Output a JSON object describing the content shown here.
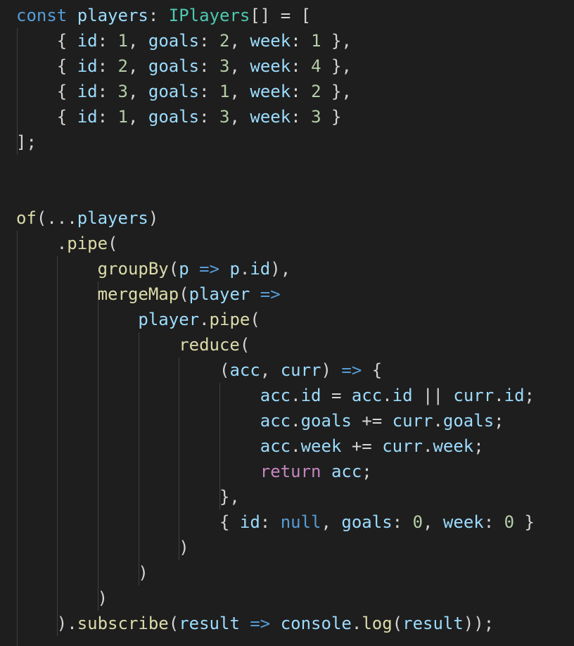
{
  "code": {
    "language": "typescript",
    "lines": [
      [
        {
          "t": "const",
          "c": "kw"
        },
        {
          "t": " ",
          "c": "plain"
        },
        {
          "t": "players",
          "c": "var"
        },
        {
          "t": ": ",
          "c": "punc"
        },
        {
          "t": "IPlayers",
          "c": "type"
        },
        {
          "t": "[] = [",
          "c": "punc"
        }
      ],
      [
        {
          "t": "    { ",
          "c": "punc"
        },
        {
          "t": "id",
          "c": "var"
        },
        {
          "t": ": ",
          "c": "punc"
        },
        {
          "t": "1",
          "c": "num"
        },
        {
          "t": ", ",
          "c": "punc"
        },
        {
          "t": "goals",
          "c": "var"
        },
        {
          "t": ": ",
          "c": "punc"
        },
        {
          "t": "2",
          "c": "num"
        },
        {
          "t": ", ",
          "c": "punc"
        },
        {
          "t": "week",
          "c": "var"
        },
        {
          "t": ": ",
          "c": "punc"
        },
        {
          "t": "1",
          "c": "num"
        },
        {
          "t": " },",
          "c": "punc"
        }
      ],
      [
        {
          "t": "    { ",
          "c": "punc"
        },
        {
          "t": "id",
          "c": "var"
        },
        {
          "t": ": ",
          "c": "punc"
        },
        {
          "t": "2",
          "c": "num"
        },
        {
          "t": ", ",
          "c": "punc"
        },
        {
          "t": "goals",
          "c": "var"
        },
        {
          "t": ": ",
          "c": "punc"
        },
        {
          "t": "3",
          "c": "num"
        },
        {
          "t": ", ",
          "c": "punc"
        },
        {
          "t": "week",
          "c": "var"
        },
        {
          "t": ": ",
          "c": "punc"
        },
        {
          "t": "4",
          "c": "num"
        },
        {
          "t": " },",
          "c": "punc"
        }
      ],
      [
        {
          "t": "    { ",
          "c": "punc"
        },
        {
          "t": "id",
          "c": "var"
        },
        {
          "t": ": ",
          "c": "punc"
        },
        {
          "t": "3",
          "c": "num"
        },
        {
          "t": ", ",
          "c": "punc"
        },
        {
          "t": "goals",
          "c": "var"
        },
        {
          "t": ": ",
          "c": "punc"
        },
        {
          "t": "1",
          "c": "num"
        },
        {
          "t": ", ",
          "c": "punc"
        },
        {
          "t": "week",
          "c": "var"
        },
        {
          "t": ": ",
          "c": "punc"
        },
        {
          "t": "2",
          "c": "num"
        },
        {
          "t": " },",
          "c": "punc"
        }
      ],
      [
        {
          "t": "    { ",
          "c": "punc"
        },
        {
          "t": "id",
          "c": "var"
        },
        {
          "t": ": ",
          "c": "punc"
        },
        {
          "t": "1",
          "c": "num"
        },
        {
          "t": ", ",
          "c": "punc"
        },
        {
          "t": "goals",
          "c": "var"
        },
        {
          "t": ": ",
          "c": "punc"
        },
        {
          "t": "3",
          "c": "num"
        },
        {
          "t": ", ",
          "c": "punc"
        },
        {
          "t": "week",
          "c": "var"
        },
        {
          "t": ": ",
          "c": "punc"
        },
        {
          "t": "3",
          "c": "num"
        },
        {
          "t": " }",
          "c": "punc"
        }
      ],
      [
        {
          "t": "];",
          "c": "punc"
        }
      ],
      [],
      [],
      [
        {
          "t": "of",
          "c": "fn"
        },
        {
          "t": "(...",
          "c": "punc"
        },
        {
          "t": "players",
          "c": "var"
        },
        {
          "t": ")",
          "c": "punc"
        }
      ],
      [
        {
          "t": "    .",
          "c": "punc"
        },
        {
          "t": "pipe",
          "c": "fn"
        },
        {
          "t": "(",
          "c": "punc"
        }
      ],
      [
        {
          "t": "        ",
          "c": "plain"
        },
        {
          "t": "groupBy",
          "c": "fn"
        },
        {
          "t": "(",
          "c": "punc"
        },
        {
          "t": "p",
          "c": "var"
        },
        {
          "t": " => ",
          "c": "kw"
        },
        {
          "t": "p",
          "c": "var"
        },
        {
          "t": ".",
          "c": "punc"
        },
        {
          "t": "id",
          "c": "var"
        },
        {
          "t": "),",
          "c": "punc"
        }
      ],
      [
        {
          "t": "        ",
          "c": "plain"
        },
        {
          "t": "mergeMap",
          "c": "fn"
        },
        {
          "t": "(",
          "c": "punc"
        },
        {
          "t": "player",
          "c": "var"
        },
        {
          "t": " =>",
          "c": "kw"
        }
      ],
      [
        {
          "t": "            ",
          "c": "plain"
        },
        {
          "t": "player",
          "c": "var"
        },
        {
          "t": ".",
          "c": "punc"
        },
        {
          "t": "pipe",
          "c": "fn"
        },
        {
          "t": "(",
          "c": "punc"
        }
      ],
      [
        {
          "t": "                ",
          "c": "plain"
        },
        {
          "t": "reduce",
          "c": "fn"
        },
        {
          "t": "(",
          "c": "punc"
        }
      ],
      [
        {
          "t": "                    (",
          "c": "punc"
        },
        {
          "t": "acc",
          "c": "var"
        },
        {
          "t": ", ",
          "c": "punc"
        },
        {
          "t": "curr",
          "c": "var"
        },
        {
          "t": ") ",
          "c": "punc"
        },
        {
          "t": "=>",
          "c": "kw"
        },
        {
          "t": " {",
          "c": "punc"
        }
      ],
      [
        {
          "t": "                        ",
          "c": "plain"
        },
        {
          "t": "acc",
          "c": "var"
        },
        {
          "t": ".",
          "c": "punc"
        },
        {
          "t": "id",
          "c": "var"
        },
        {
          "t": " = ",
          "c": "op"
        },
        {
          "t": "acc",
          "c": "var"
        },
        {
          "t": ".",
          "c": "punc"
        },
        {
          "t": "id",
          "c": "var"
        },
        {
          "t": " || ",
          "c": "op"
        },
        {
          "t": "curr",
          "c": "var"
        },
        {
          "t": ".",
          "c": "punc"
        },
        {
          "t": "id",
          "c": "var"
        },
        {
          "t": ";",
          "c": "punc"
        }
      ],
      [
        {
          "t": "                        ",
          "c": "plain"
        },
        {
          "t": "acc",
          "c": "var"
        },
        {
          "t": ".",
          "c": "punc"
        },
        {
          "t": "goals",
          "c": "var"
        },
        {
          "t": " += ",
          "c": "op"
        },
        {
          "t": "curr",
          "c": "var"
        },
        {
          "t": ".",
          "c": "punc"
        },
        {
          "t": "goals",
          "c": "var"
        },
        {
          "t": ";",
          "c": "punc"
        }
      ],
      [
        {
          "t": "                        ",
          "c": "plain"
        },
        {
          "t": "acc",
          "c": "var"
        },
        {
          "t": ".",
          "c": "punc"
        },
        {
          "t": "week",
          "c": "var"
        },
        {
          "t": " += ",
          "c": "op"
        },
        {
          "t": "curr",
          "c": "var"
        },
        {
          "t": ".",
          "c": "punc"
        },
        {
          "t": "week",
          "c": "var"
        },
        {
          "t": ";",
          "c": "punc"
        }
      ],
      [
        {
          "t": "                        ",
          "c": "plain"
        },
        {
          "t": "return",
          "c": "kw2"
        },
        {
          "t": " ",
          "c": "plain"
        },
        {
          "t": "acc",
          "c": "var"
        },
        {
          "t": ";",
          "c": "punc"
        }
      ],
      [
        {
          "t": "                    },",
          "c": "punc"
        }
      ],
      [
        {
          "t": "                    { ",
          "c": "punc"
        },
        {
          "t": "id",
          "c": "var"
        },
        {
          "t": ": ",
          "c": "punc"
        },
        {
          "t": "null",
          "c": "kw"
        },
        {
          "t": ", ",
          "c": "punc"
        },
        {
          "t": "goals",
          "c": "var"
        },
        {
          "t": ": ",
          "c": "punc"
        },
        {
          "t": "0",
          "c": "num"
        },
        {
          "t": ", ",
          "c": "punc"
        },
        {
          "t": "week",
          "c": "var"
        },
        {
          "t": ": ",
          "c": "punc"
        },
        {
          "t": "0",
          "c": "num"
        },
        {
          "t": " }",
          "c": "punc"
        }
      ],
      [
        {
          "t": "                )",
          "c": "punc"
        }
      ],
      [
        {
          "t": "            )",
          "c": "punc"
        }
      ],
      [
        {
          "t": "        )",
          "c": "punc"
        }
      ],
      [
        {
          "t": "    ).",
          "c": "punc"
        },
        {
          "t": "subscribe",
          "c": "fn"
        },
        {
          "t": "(",
          "c": "punc"
        },
        {
          "t": "result",
          "c": "var"
        },
        {
          "t": " => ",
          "c": "kw"
        },
        {
          "t": "console",
          "c": "var"
        },
        {
          "t": ".",
          "c": "punc"
        },
        {
          "t": "log",
          "c": "fn"
        },
        {
          "t": "(",
          "c": "punc"
        },
        {
          "t": "result",
          "c": "var"
        },
        {
          "t": "));",
          "c": "punc"
        }
      ]
    ]
  },
  "colors": {
    "background": "#1e1e1e",
    "keyword": "#569cd6",
    "control_keyword": "#c586c0",
    "variable": "#9cdcfe",
    "type": "#4ec9b0",
    "function": "#dcdcaa",
    "number": "#b5cea8",
    "punctuation": "#d4d4d4",
    "indent_guide": "#404040"
  }
}
